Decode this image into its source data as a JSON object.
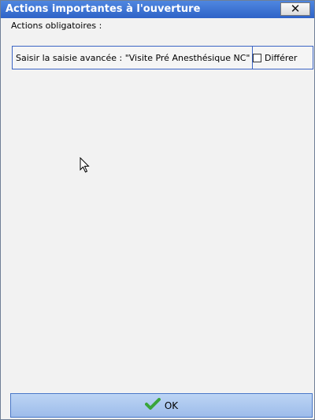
{
  "window": {
    "title": "Actions importantes à l'ouverture",
    "close_label": "✕"
  },
  "content": {
    "section_label": "Actions obligatoires :",
    "actions": [
      {
        "text": "Saisir la saisie avancée : \"Visite Pré Anesthésique NC\"",
        "defer_label": "Différer",
        "defer_checked": false
      }
    ]
  },
  "footer": {
    "ok_label": "OK",
    "ok_icon": "checkmark-icon"
  },
  "colors": {
    "titlebar": "#3a70d6",
    "accent_border": "#3b64c4",
    "ok_button": "#a9c6ee",
    "checkmark": "#3aa53a"
  }
}
